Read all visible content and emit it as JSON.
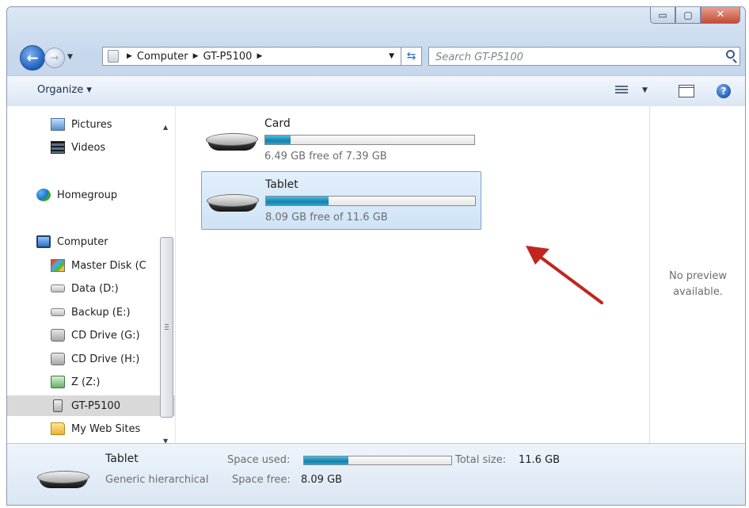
{
  "window": {
    "minimize_glyph": "▭",
    "maximize_glyph": "▢",
    "close_glyph": "✕"
  },
  "navigation": {
    "back_glyph": "←",
    "forward_glyph": "→",
    "dropdown_glyph": "▼",
    "breadcrumb_sep": "▶",
    "breadcrumbs": [
      "Computer",
      "GT-P5100"
    ],
    "refresh_glyph": "⇆",
    "search_placeholder": "Search GT-P5100"
  },
  "toolbar": {
    "organize_label": "Organize ▾",
    "view_dropdown": "▼",
    "help_glyph": "?"
  },
  "sidebar": {
    "scroll_up": "▲",
    "scroll_down": "▼",
    "items": [
      {
        "label": "Pictures",
        "icon": "pictures-icon"
      },
      {
        "label": "Videos",
        "icon": "videos-icon"
      },
      {
        "label": "Homegroup",
        "icon": "homegroup-icon"
      },
      {
        "label": "Computer",
        "icon": "computer-icon"
      },
      {
        "label": "Master Disk (C",
        "icon": "system-drive-icon"
      },
      {
        "label": "Data (D:)",
        "icon": "drive-icon"
      },
      {
        "label": "Backup (E:)",
        "icon": "drive-icon"
      },
      {
        "label": "CD Drive (G:)",
        "icon": "cd-drive-icon"
      },
      {
        "label": "CD Drive (H:)",
        "icon": "cd-drive-icon"
      },
      {
        "label": "Z (Z:)",
        "icon": "network-drive-icon"
      },
      {
        "label": "GT-P5100",
        "icon": "device-icon",
        "selected": true
      },
      {
        "label": "My Web Sites",
        "icon": "folder-icon"
      }
    ]
  },
  "drives": [
    {
      "name": "Card",
      "free_text": "6.49 GB free of 7.39 GB",
      "used_fraction": 0.12,
      "selected": false
    },
    {
      "name": "Tablet",
      "free_text": "8.09 GB free of 11.6 GB",
      "used_fraction": 0.3,
      "selected": true
    }
  ],
  "preview": {
    "message_line1": "No preview",
    "message_line2": "available."
  },
  "details": {
    "name": "Tablet",
    "type": "Generic hierarchical",
    "space_used_label": "Space used:",
    "space_used_fraction": 0.3,
    "total_size_label": "Total size:",
    "total_size_value": "11.6 GB",
    "space_free_label": "Space free:",
    "space_free_value": "8.09 GB"
  },
  "colors": {
    "accent": "#1a7fa8",
    "selection": "#cfe3f7",
    "annotation_arrow": "#c0261d"
  }
}
